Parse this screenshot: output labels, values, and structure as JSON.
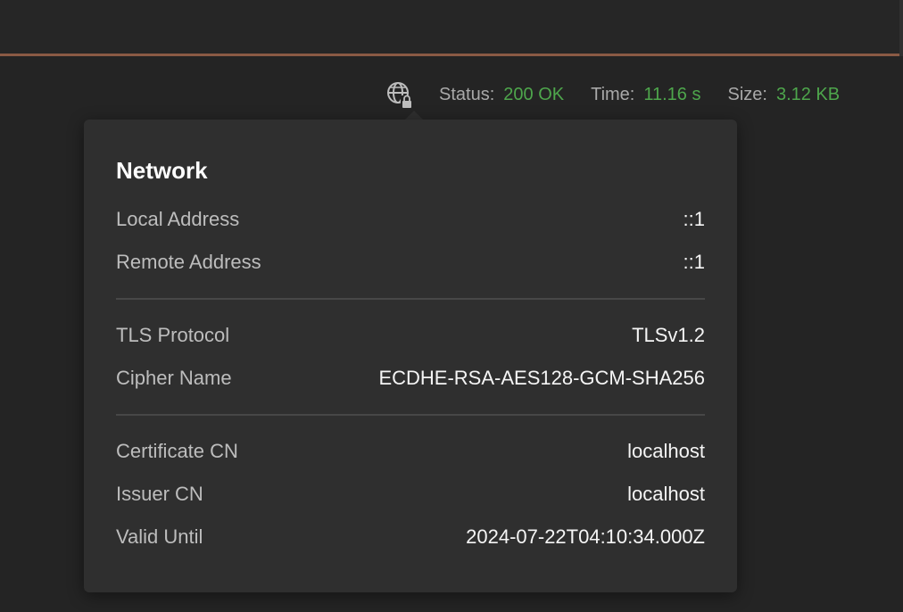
{
  "status_bar": {
    "icon": "globe-lock-icon",
    "status_label": "Status:",
    "status_value": "200 OK",
    "time_label": "Time:",
    "time_value": "11.16 s",
    "size_label": "Size:",
    "size_value": "3.12 KB",
    "value_color": "#4ea64c"
  },
  "network_popover": {
    "title": "Network",
    "groups": [
      {
        "rows": [
          {
            "label": "Local Address",
            "value": "::1"
          },
          {
            "label": "Remote Address",
            "value": "::1"
          }
        ]
      },
      {
        "rows": [
          {
            "label": "TLS Protocol",
            "value": "TLSv1.2"
          },
          {
            "label": "Cipher Name",
            "value": "ECDHE-RSA-AES128-GCM-SHA256"
          }
        ]
      },
      {
        "rows": [
          {
            "label": "Certificate CN",
            "value": "localhost"
          },
          {
            "label": "Issuer CN",
            "value": "localhost"
          },
          {
            "label": "Valid Until",
            "value": "2024-07-22T04:10:34.000Z"
          }
        ]
      }
    ]
  }
}
